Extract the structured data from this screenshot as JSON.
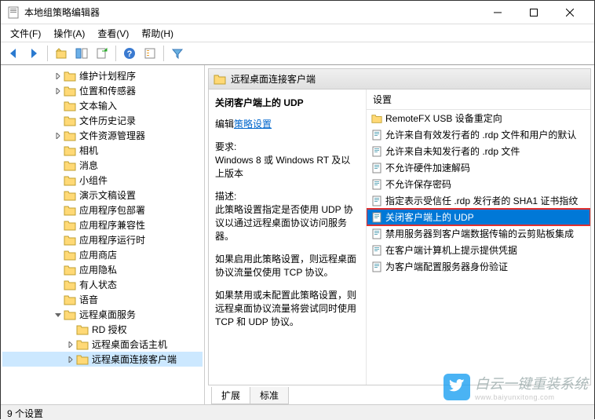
{
  "window": {
    "title": "本地组策略编辑器"
  },
  "menu": {
    "file": "文件(F)",
    "action": "操作(A)",
    "view": "查看(V)",
    "help": "帮助(H)"
  },
  "tree": {
    "items": [
      {
        "label": "维护计划程序",
        "depth": 4,
        "toggle": ">"
      },
      {
        "label": "位置和传感器",
        "depth": 4,
        "toggle": ">"
      },
      {
        "label": "文本输入",
        "depth": 4,
        "toggle": ""
      },
      {
        "label": "文件历史记录",
        "depth": 4,
        "toggle": ""
      },
      {
        "label": "文件资源管理器",
        "depth": 4,
        "toggle": ">"
      },
      {
        "label": "相机",
        "depth": 4,
        "toggle": ""
      },
      {
        "label": "消息",
        "depth": 4,
        "toggle": ""
      },
      {
        "label": "小组件",
        "depth": 4,
        "toggle": ""
      },
      {
        "label": "演示文稿设置",
        "depth": 4,
        "toggle": ""
      },
      {
        "label": "应用程序包部署",
        "depth": 4,
        "toggle": ""
      },
      {
        "label": "应用程序兼容性",
        "depth": 4,
        "toggle": ""
      },
      {
        "label": "应用程序运行时",
        "depth": 4,
        "toggle": ""
      },
      {
        "label": "应用商店",
        "depth": 4,
        "toggle": ""
      },
      {
        "label": "应用隐私",
        "depth": 4,
        "toggle": ""
      },
      {
        "label": "有人状态",
        "depth": 4,
        "toggle": ""
      },
      {
        "label": "语音",
        "depth": 4,
        "toggle": ""
      },
      {
        "label": "远程桌面服务",
        "depth": 4,
        "toggle": "v",
        "expanded": true
      },
      {
        "label": "RD 授权",
        "depth": 5,
        "toggle": ""
      },
      {
        "label": "远程桌面会话主机",
        "depth": 5,
        "toggle": ">"
      },
      {
        "label": "远程桌面连接客户端",
        "depth": 5,
        "toggle": ">",
        "selected": true
      }
    ]
  },
  "rightHeader": {
    "title": "远程桌面连接客户端"
  },
  "details": {
    "title": "关闭客户端上的 UDP",
    "editPrefix": "编辑",
    "editLink": "策略设置",
    "reqLabel": "要求:",
    "reqText": "Windows 8 或 Windows RT 及以上版本",
    "descLabel": "描述:",
    "descText1": "此策略设置指定是否使用 UDP 协议以通过远程桌面协议访问服务器。",
    "descText2": "如果启用此策略设置，则远程桌面协议流量仅使用 TCP 协议。",
    "descText3": "如果禁用或未配置此策略设置，则远程桌面协议流量将尝试同时使用 TCP 和 UDP 协议。"
  },
  "listHeader": "设置",
  "settings": [
    {
      "label": "RemoteFX USB 设备重定向",
      "kind": "folder"
    },
    {
      "label": "允许来自有效发行者的 .rdp 文件和用户的默认",
      "kind": "policy"
    },
    {
      "label": "允许来自未知发行者的 .rdp 文件",
      "kind": "policy"
    },
    {
      "label": "不允许硬件加速解码",
      "kind": "policy"
    },
    {
      "label": "不允许保存密码",
      "kind": "policy"
    },
    {
      "label": "指定表示受信任 .rdp 发行者的 SHA1 证书指纹",
      "kind": "policy"
    },
    {
      "label": "关闭客户端上的 UDP",
      "kind": "policy",
      "selected": true
    },
    {
      "label": "禁用服务器到客户端数据传输的云剪贴板集成",
      "kind": "policy"
    },
    {
      "label": "在客户端计算机上提示提供凭据",
      "kind": "policy"
    },
    {
      "label": "为客户端配置服务器身份验证",
      "kind": "policy"
    }
  ],
  "tabs": {
    "extended": "扩展",
    "standard": "标准"
  },
  "status": "9 个设置",
  "watermark": {
    "main": "白云一键重装系统",
    "sub": "www.baiyunxitong.com"
  }
}
